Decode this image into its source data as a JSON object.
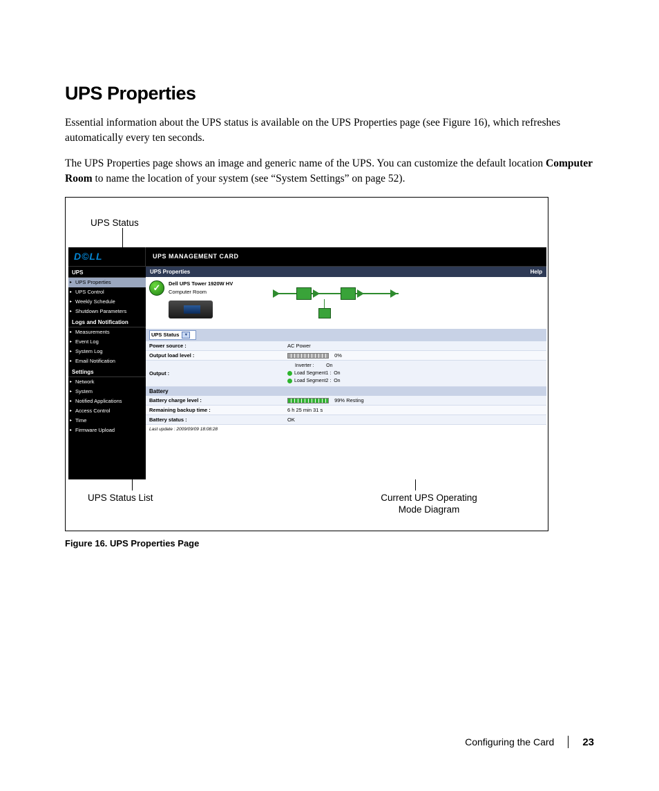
{
  "page": {
    "heading": "UPS Properties",
    "para1": "Essential information about the UPS status is available on the UPS Properties page (see Figure 16), which refreshes automatically every ten seconds.",
    "para2_pre": "The UPS Properties page shows an image and generic name of the UPS. You can customize the default location ",
    "para2_bold": "Computer Room",
    "para2_post": " to name the location of your system (see “System Settings” on page 52).",
    "caption": "Figure 16. UPS Properties Page",
    "footer_label": "Configuring the Card",
    "footer_page": "23"
  },
  "callouts": {
    "top": "UPS Status",
    "bottom_left": "UPS Status List",
    "bottom_right_l1": "Current UPS Operating",
    "bottom_right_l2": "Mode Diagram"
  },
  "app": {
    "logo_text": "D©LL",
    "card_title": "UPS MANAGEMENT CARD",
    "panel_title": "UPS Properties",
    "help": "Help",
    "device_name": "Dell UPS Tower 1920W HV",
    "device_loc": "Computer Room",
    "status_icon": "✓",
    "dropdown_label": "UPS Status",
    "last_update": "Last update : 2009/09/09 18:08:28",
    "sidebar": {
      "sections": [
        {
          "title": "UPS",
          "items": [
            "UPS Properties",
            "UPS Control",
            "Weekly Schedule",
            "Shutdown Parameters"
          ]
        },
        {
          "title": "Logs and Notification",
          "items": [
            "Measurements",
            "Event Log",
            "System Log",
            "Email Notification"
          ]
        },
        {
          "title": "Settings",
          "items": [
            "Network",
            "System",
            "Notified Applications",
            "Access Control",
            "Time",
            "Firmware Upload"
          ]
        }
      ]
    },
    "rows": {
      "power_source_lbl": "Power source :",
      "power_source_val": "AC Power",
      "output_load_lbl": "Output load level :",
      "output_load_val": "0%",
      "output_lbl": "Output :",
      "inverter_lbl": "Inverter :",
      "inverter_val": "On",
      "seg1_lbl": "Load Segment1 :",
      "seg1_val": "On",
      "seg2_lbl": "Load Segment2 :",
      "seg2_val": "On",
      "battery_hdr": "Battery",
      "charge_lbl": "Battery charge level :",
      "charge_val": "99%  Resting",
      "backup_lbl": "Remaining backup time :",
      "backup_val": "6 h 25 min 31 s",
      "status_lbl": "Battery status :",
      "status_val": "OK"
    }
  }
}
